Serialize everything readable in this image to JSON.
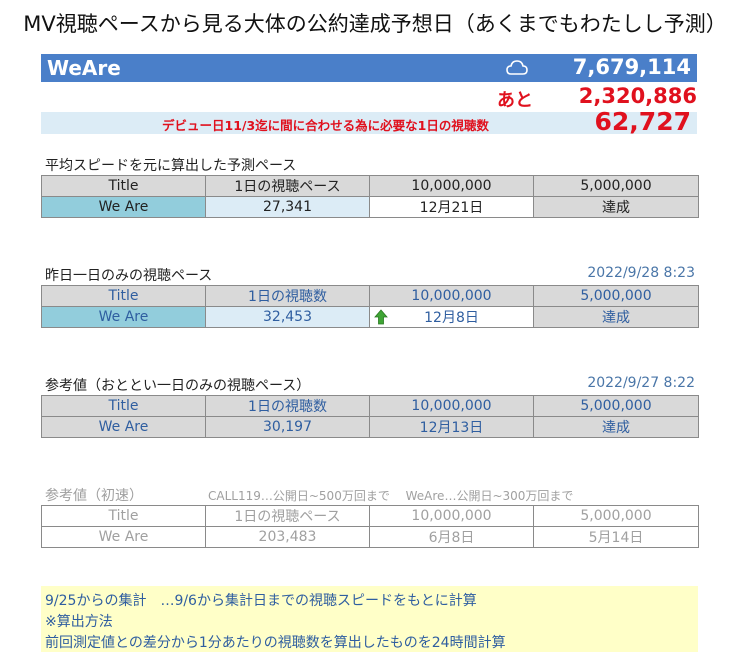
{
  "title": "MV視聴ペースから見る大体の公約達成予想日（あくまでもわたしし予測）",
  "summary": {
    "artist": "WeAre",
    "current_views": "7,679,114",
    "remaining_label": "あと",
    "remaining": "2,320,886",
    "need_label": "デビュー日11/3迄に間に合わせる為に必要な1日の視聴数",
    "need_value": "62,727"
  },
  "avg": {
    "heading": "平均スピードを元に算出した予測ペース",
    "headers": [
      "Title",
      "1日の視聴ペース",
      "10,000,000",
      "5,000,000"
    ],
    "row": [
      "We Are",
      "27,341",
      "12月21日",
      "達成"
    ]
  },
  "yesterday": {
    "heading": "昨日一日のみの視聴ペース",
    "stamp": "2022/9/28 8:23",
    "headers": [
      "Title",
      "1日の視聴数",
      "10,000,000",
      "5,000,000"
    ],
    "row": [
      "We Are",
      "32,453",
      "12月8日",
      "達成"
    ]
  },
  "ref": {
    "heading": "参考値（おととい一日のみの視聴ペース）",
    "stamp": "2022/9/27 8:22",
    "headers": [
      "Title",
      "1日の視聴数",
      "10,000,000",
      "5,000,000"
    ],
    "row": [
      "We Are",
      "30,197",
      "12月13日",
      "達成"
    ]
  },
  "first": {
    "heading": "参考値（初速）",
    "note": "CALL119…公開日~500万回まで　 WeAre…公開日~300万回まで",
    "headers": [
      "Title",
      "1日の視聴ペース",
      "10,000,000",
      "5,000,000"
    ],
    "row": [
      "We Are",
      "203,483",
      "6月8日",
      "5月14日"
    ]
  },
  "notes": [
    "9/25からの集計　…9/6から集計日までの視聴スピードをもとに計算",
    "※算出方法",
    "前回測定値との差分から1分あたりの視聴数を算出したものを24時間計算"
  ],
  "icons": {
    "weather": "cloud-icon",
    "trend": "up-arrow-icon"
  },
  "colors": {
    "bar": "#4a7fc9",
    "red": "#e0111e",
    "blue_text": "#2f5ea0",
    "highlight": "#92cddc",
    "note_bg": "#ffffc8"
  }
}
